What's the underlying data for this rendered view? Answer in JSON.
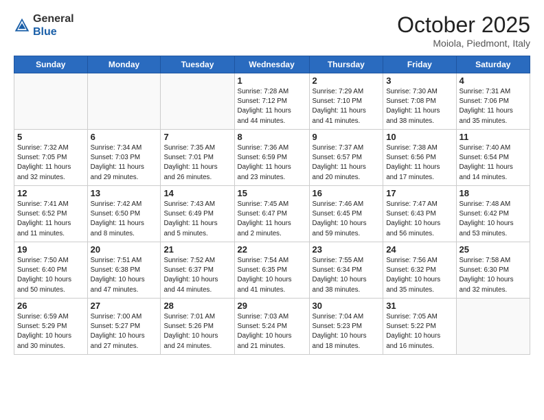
{
  "header": {
    "logo_general": "General",
    "logo_blue": "Blue",
    "month_title": "October 2025",
    "subtitle": "Moiola, Piedmont, Italy"
  },
  "days_of_week": [
    "Sunday",
    "Monday",
    "Tuesday",
    "Wednesday",
    "Thursday",
    "Friday",
    "Saturday"
  ],
  "weeks": [
    [
      {
        "day": "",
        "info": ""
      },
      {
        "day": "",
        "info": ""
      },
      {
        "day": "",
        "info": ""
      },
      {
        "day": "1",
        "info": "Sunrise: 7:28 AM\nSunset: 7:12 PM\nDaylight: 11 hours\nand 44 minutes."
      },
      {
        "day": "2",
        "info": "Sunrise: 7:29 AM\nSunset: 7:10 PM\nDaylight: 11 hours\nand 41 minutes."
      },
      {
        "day": "3",
        "info": "Sunrise: 7:30 AM\nSunset: 7:08 PM\nDaylight: 11 hours\nand 38 minutes."
      },
      {
        "day": "4",
        "info": "Sunrise: 7:31 AM\nSunset: 7:06 PM\nDaylight: 11 hours\nand 35 minutes."
      }
    ],
    [
      {
        "day": "5",
        "info": "Sunrise: 7:32 AM\nSunset: 7:05 PM\nDaylight: 11 hours\nand 32 minutes."
      },
      {
        "day": "6",
        "info": "Sunrise: 7:34 AM\nSunset: 7:03 PM\nDaylight: 11 hours\nand 29 minutes."
      },
      {
        "day": "7",
        "info": "Sunrise: 7:35 AM\nSunset: 7:01 PM\nDaylight: 11 hours\nand 26 minutes."
      },
      {
        "day": "8",
        "info": "Sunrise: 7:36 AM\nSunset: 6:59 PM\nDaylight: 11 hours\nand 23 minutes."
      },
      {
        "day": "9",
        "info": "Sunrise: 7:37 AM\nSunset: 6:57 PM\nDaylight: 11 hours\nand 20 minutes."
      },
      {
        "day": "10",
        "info": "Sunrise: 7:38 AM\nSunset: 6:56 PM\nDaylight: 11 hours\nand 17 minutes."
      },
      {
        "day": "11",
        "info": "Sunrise: 7:40 AM\nSunset: 6:54 PM\nDaylight: 11 hours\nand 14 minutes."
      }
    ],
    [
      {
        "day": "12",
        "info": "Sunrise: 7:41 AM\nSunset: 6:52 PM\nDaylight: 11 hours\nand 11 minutes."
      },
      {
        "day": "13",
        "info": "Sunrise: 7:42 AM\nSunset: 6:50 PM\nDaylight: 11 hours\nand 8 minutes."
      },
      {
        "day": "14",
        "info": "Sunrise: 7:43 AM\nSunset: 6:49 PM\nDaylight: 11 hours\nand 5 minutes."
      },
      {
        "day": "15",
        "info": "Sunrise: 7:45 AM\nSunset: 6:47 PM\nDaylight: 11 hours\nand 2 minutes."
      },
      {
        "day": "16",
        "info": "Sunrise: 7:46 AM\nSunset: 6:45 PM\nDaylight: 10 hours\nand 59 minutes."
      },
      {
        "day": "17",
        "info": "Sunrise: 7:47 AM\nSunset: 6:43 PM\nDaylight: 10 hours\nand 56 minutes."
      },
      {
        "day": "18",
        "info": "Sunrise: 7:48 AM\nSunset: 6:42 PM\nDaylight: 10 hours\nand 53 minutes."
      }
    ],
    [
      {
        "day": "19",
        "info": "Sunrise: 7:50 AM\nSunset: 6:40 PM\nDaylight: 10 hours\nand 50 minutes."
      },
      {
        "day": "20",
        "info": "Sunrise: 7:51 AM\nSunset: 6:38 PM\nDaylight: 10 hours\nand 47 minutes."
      },
      {
        "day": "21",
        "info": "Sunrise: 7:52 AM\nSunset: 6:37 PM\nDaylight: 10 hours\nand 44 minutes."
      },
      {
        "day": "22",
        "info": "Sunrise: 7:54 AM\nSunset: 6:35 PM\nDaylight: 10 hours\nand 41 minutes."
      },
      {
        "day": "23",
        "info": "Sunrise: 7:55 AM\nSunset: 6:34 PM\nDaylight: 10 hours\nand 38 minutes."
      },
      {
        "day": "24",
        "info": "Sunrise: 7:56 AM\nSunset: 6:32 PM\nDaylight: 10 hours\nand 35 minutes."
      },
      {
        "day": "25",
        "info": "Sunrise: 7:58 AM\nSunset: 6:30 PM\nDaylight: 10 hours\nand 32 minutes."
      }
    ],
    [
      {
        "day": "26",
        "info": "Sunrise: 6:59 AM\nSunset: 5:29 PM\nDaylight: 10 hours\nand 30 minutes."
      },
      {
        "day": "27",
        "info": "Sunrise: 7:00 AM\nSunset: 5:27 PM\nDaylight: 10 hours\nand 27 minutes."
      },
      {
        "day": "28",
        "info": "Sunrise: 7:01 AM\nSunset: 5:26 PM\nDaylight: 10 hours\nand 24 minutes."
      },
      {
        "day": "29",
        "info": "Sunrise: 7:03 AM\nSunset: 5:24 PM\nDaylight: 10 hours\nand 21 minutes."
      },
      {
        "day": "30",
        "info": "Sunrise: 7:04 AM\nSunset: 5:23 PM\nDaylight: 10 hours\nand 18 minutes."
      },
      {
        "day": "31",
        "info": "Sunrise: 7:05 AM\nSunset: 5:22 PM\nDaylight: 10 hours\nand 16 minutes."
      },
      {
        "day": "",
        "info": ""
      }
    ]
  ]
}
